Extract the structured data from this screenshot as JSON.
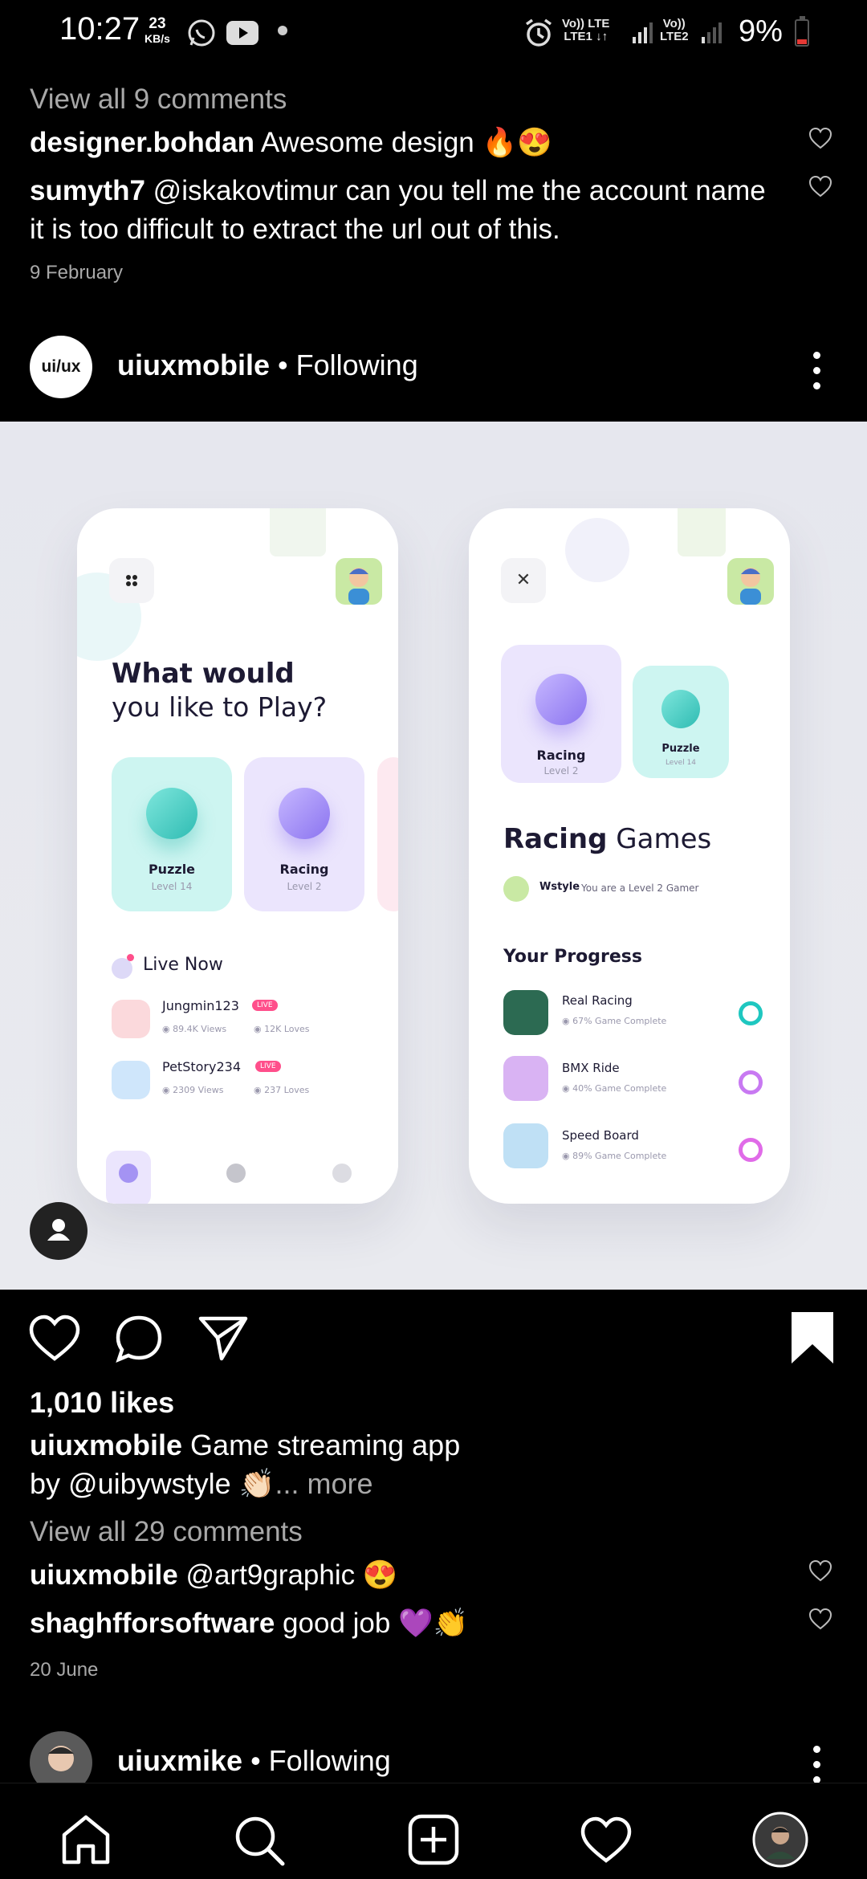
{
  "status_bar": {
    "time": "10:27",
    "speed_value": "23",
    "speed_unit": "KB/s",
    "net1_top": "Vo)) LTE",
    "net1_bottom": "LTE1 ↓↑",
    "net2_top": "Vo))",
    "net2_bottom": "LTE2",
    "battery": "9%"
  },
  "prev_post": {
    "view_comments": "View all 9 comments",
    "comments": [
      {
        "user": "designer.bohdan",
        "text": "Awesome design 🔥😍"
      },
      {
        "user": "sumyth7",
        "text_line1": "@iskakovtimur can you tell me the account name",
        "text_line2": "it is too difficult to extract the url out of this."
      }
    ],
    "date": "9 February"
  },
  "post": {
    "avatar_text": "ui/ux",
    "username": "uiuxmobile",
    "follow_status": "• Following",
    "image": {
      "left_phone": {
        "title_bold": "What would",
        "title_rest": "you like to Play?",
        "cards": [
          {
            "name": "Puzzle",
            "level": "Level 14"
          },
          {
            "name": "Racing",
            "level": "Level 2"
          }
        ],
        "live_title": "Live Now",
        "live_items": [
          {
            "name": "Jungmin123",
            "badge": "LIVE",
            "views": "89.4K Views",
            "loves": "12K Loves"
          },
          {
            "name": "PetStory234",
            "badge": "LIVE",
            "views": "2309 Views",
            "loves": "237 Loves"
          }
        ]
      },
      "right_phone": {
        "close": "✕",
        "cards": [
          {
            "name": "Racing",
            "level": "Level 2"
          },
          {
            "name": "Puzzle",
            "level": "Level 14"
          }
        ],
        "heading_bold": "Racing",
        "heading_rest": "Games",
        "user_name": "Wstyle",
        "user_level": "You are a Level 2 Gamer",
        "progress_title": "Your Progress",
        "progress": [
          {
            "name": "Real Racing",
            "status": "67% Game Complete",
            "color": "#1fc7c0"
          },
          {
            "name": "BMX Ride",
            "status": "40% Game Complete",
            "color": "#c879f2"
          },
          {
            "name": "Speed Board",
            "status": "89% Game Complete",
            "color": "#e06be8"
          }
        ]
      }
    },
    "likes": "1,010 likes",
    "caption_user": "uiuxmobile",
    "caption_line1": "Game streaming app",
    "caption_line2": "by @uibywstyle 👏🏻",
    "caption_more": "... more",
    "view_comments": "View all 29 comments",
    "comments": [
      {
        "user": "uiuxmobile",
        "text": "@art9graphic 😍"
      },
      {
        "user": "shaghfforsoftware",
        "text": "good job 💜👏"
      }
    ],
    "date": "20 June"
  },
  "next_post": {
    "username": "uiuxmike",
    "follow_status": "• Following"
  },
  "nav": {
    "items": [
      "home-icon",
      "search-icon",
      "create-icon",
      "activity-icon",
      "profile-avatar"
    ]
  }
}
